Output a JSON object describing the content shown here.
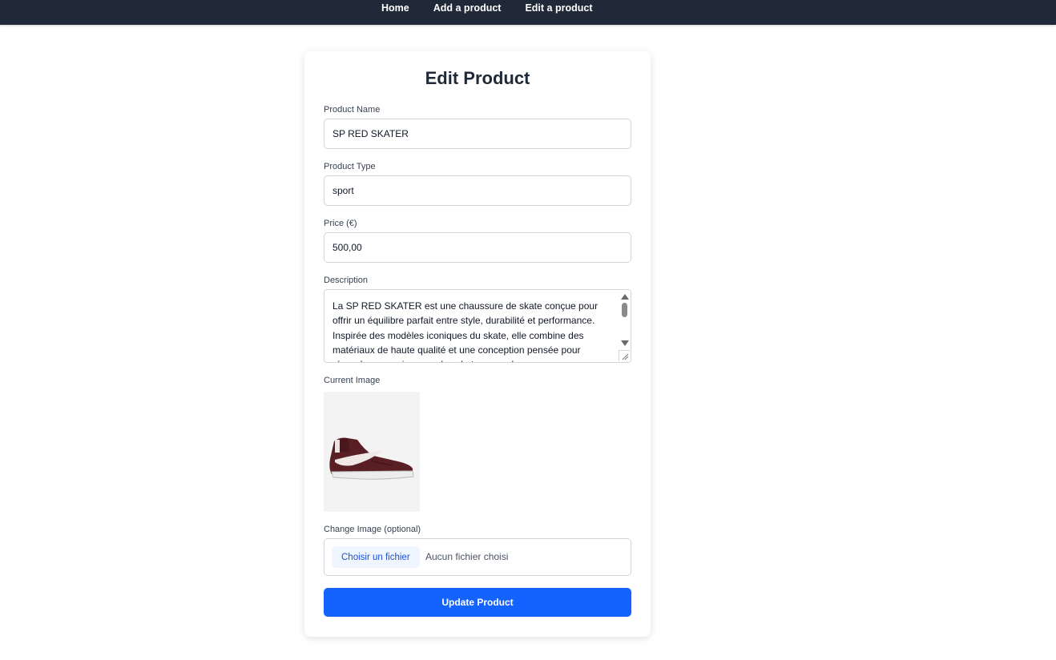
{
  "nav": {
    "items": [
      {
        "label": "Home"
      },
      {
        "label": "Add a product"
      },
      {
        "label": "Edit a product"
      }
    ]
  },
  "form": {
    "title": "Edit Product",
    "name": {
      "label": "Product Name",
      "value": "SP RED SKATER"
    },
    "type": {
      "label": "Product Type",
      "value": "sport"
    },
    "price": {
      "label": "Price (€)",
      "value": "500,00"
    },
    "description": {
      "label": "Description",
      "value": "La SP RED SKATER est une chaussure de skate conçue pour offrir un équilibre parfait entre style, durabilité et performance. Inspirée des modèles iconiques du skate, elle combine des matériaux de haute qualité et une conception pensée pour répondre aux exigences des skateurs modernes."
    },
    "current_image": {
      "label": "Current Image",
      "alt": "product-shoe-icon"
    },
    "change_image": {
      "label": "Change Image (optional)",
      "button_label": "Choisir un fichier",
      "status": "Aucun fichier choisi"
    },
    "submit_label": "Update Product"
  },
  "colors": {
    "navbar": "#1f2937",
    "primary_button": "#1563ff",
    "file_button_bg": "#eff6ff",
    "shoe": "#5a1f24"
  }
}
